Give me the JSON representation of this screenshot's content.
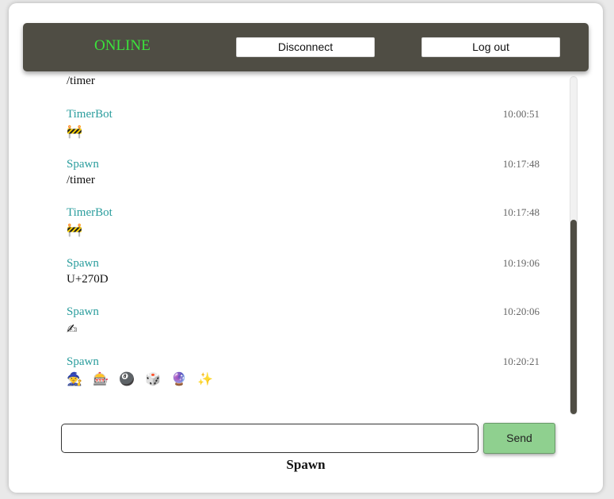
{
  "header": {
    "status": "ONLINE",
    "disconnect_label": "Disconnect",
    "logout_label": "Log out"
  },
  "partial_message": "/timer",
  "messages": [
    {
      "name": "TimerBot",
      "time": "10:00:51",
      "body": "🚧"
    },
    {
      "name": "Spawn",
      "time": "10:17:48",
      "body": "/timer"
    },
    {
      "name": "TimerBot",
      "time": "10:17:48",
      "body": "🚧"
    },
    {
      "name": "Spawn",
      "time": "10:19:06",
      "body": "U+270D"
    },
    {
      "name": "Spawn",
      "time": "10:20:06",
      "body": "✍"
    },
    {
      "name": "Spawn",
      "time": "10:20:21",
      "body": "🧙 🎰 🎱 🎲 🔮 ✨"
    }
  ],
  "composer": {
    "value": "",
    "send_label": "Send"
  },
  "current_user": "Spawn",
  "colors": {
    "header_bg": "#4f4d44",
    "status_online": "#3be33b",
    "username": "#2a9d9d",
    "send_bg": "#8fd08f"
  }
}
